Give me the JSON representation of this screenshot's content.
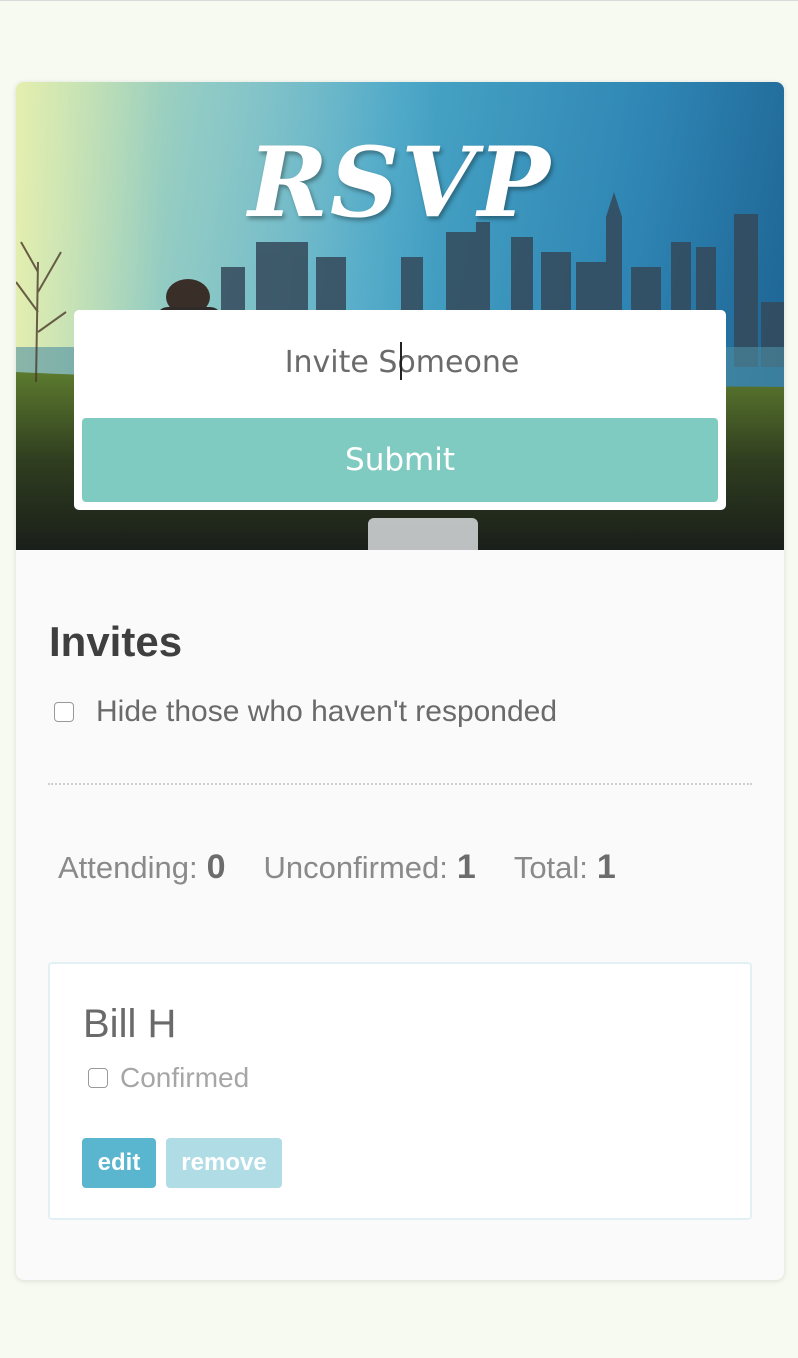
{
  "header": {
    "logo_text": "RSVP"
  },
  "invite_form": {
    "input_value": "Invite Someone",
    "submit_label": "Submit"
  },
  "invites": {
    "title": "Invites",
    "hide_filter_label": "Hide those who haven't responded",
    "hide_filter_checked": false
  },
  "stats": {
    "attending_label": "Attending:",
    "attending_count": "0",
    "unconfirmed_label": "Unconfirmed:",
    "unconfirmed_count": "1",
    "total_label": "Total:",
    "total_count": "1"
  },
  "guests": [
    {
      "name": "Bill H",
      "confirmed_label": "Confirmed",
      "confirmed": false,
      "edit_label": "edit",
      "remove_label": "remove"
    }
  ],
  "colors": {
    "page_background": "#f6faf1",
    "submit_button": "#80cbc1",
    "edit_button": "#5ab5cf",
    "remove_button": "#b0dce6"
  }
}
